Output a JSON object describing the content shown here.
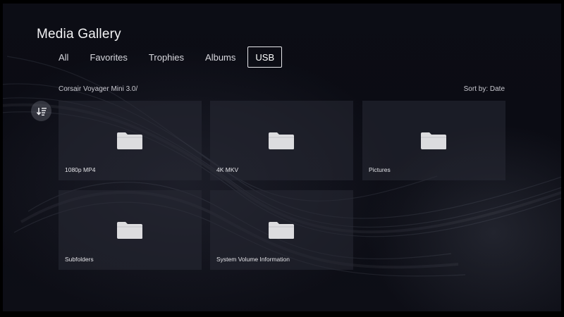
{
  "header": {
    "title": "Media Gallery"
  },
  "tabs": [
    {
      "label": "All",
      "active": false
    },
    {
      "label": "Favorites",
      "active": false
    },
    {
      "label": "Trophies",
      "active": false
    },
    {
      "label": "Albums",
      "active": false
    },
    {
      "label": "USB",
      "active": true
    }
  ],
  "location": {
    "path": "Corsair Voyager Mini 3.0/"
  },
  "sort": {
    "label": "Sort by: Date"
  },
  "sort_button": {
    "icon": "sort-list-icon"
  },
  "folders": [
    {
      "name": "1080p MP4",
      "icon": "folder-icon"
    },
    {
      "name": "4K MKV",
      "icon": "folder-icon"
    },
    {
      "name": "Pictures",
      "icon": "folder-icon"
    },
    {
      "name": "Subfolders",
      "icon": "folder-icon"
    },
    {
      "name": "System Volume Information",
      "icon": "folder-icon"
    }
  ],
  "colors": {
    "background": "#0c0d15",
    "tile": "#282934",
    "folder": "#e0e0e0",
    "text": "#ffffff"
  }
}
